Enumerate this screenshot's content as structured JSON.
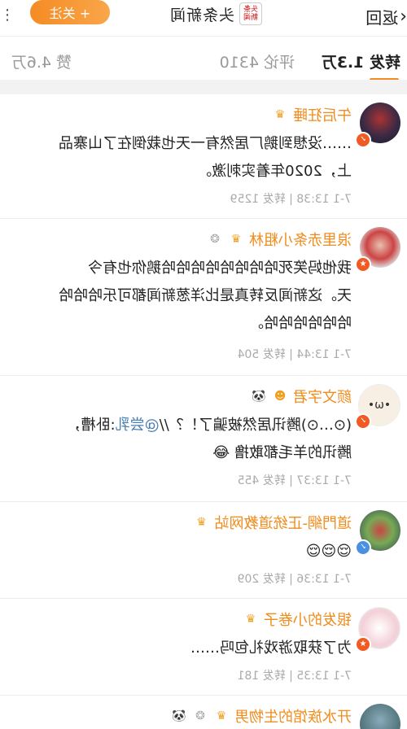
{
  "nav": {
    "back_label": "返回",
    "brand_logo_text": "头条新闻",
    "brand_name": "头条新闻",
    "follow_label": "+ 关注",
    "more_icon": "more-dots-icon"
  },
  "tabs": {
    "repost": "转发 1.3万",
    "comment": "评论 4310",
    "like": "赞 4.6万"
  },
  "posts": [
    {
      "name": "午后狂睡",
      "text1": "……没想到鹅厂居然有一天也栽倒在了山寨品",
      "text2": "上，2020年着实刺激。",
      "meta": "7-1 13:38 | 转发 1259",
      "badge_color": "#f15a22"
    },
    {
      "name": "浪里赤条小粗林",
      "text1": "我他妈笑死哈哈哈哈哈哈哈哈鹅你也有今",
      "text2": "天。这新闻反转真是比洋葱新闻都可乐哈哈哈",
      "text3": "哈哈哈哈哈哈。",
      "meta": "7-1 13:44 | 转发 504",
      "badge_color": "#f15a22"
    },
    {
      "name": "颜文字君",
      "text1_pre": "(⊙…⊙)腾讯居然被骗了！？//",
      "text1_mention": "@尝乳",
      "text1_post": ":卧槽，",
      "text2": "腾讯的羊毛都敢撸 😂",
      "meta": "7-1 13:37 | 转发 455",
      "badge_color": "#f15a22"
    },
    {
      "name": "道門網-正统道教网站",
      "text1": "😌😌😌",
      "meta": "7-1 13:36 | 转发 209",
      "badge_color": "#4a90e2"
    },
    {
      "name": "银发的小卷子",
      "text1": "为了获取游戏礼包吗……",
      "meta": "7-1 13:35 | 转发 181",
      "badge_color": "#f15a22"
    },
    {
      "name": "开水族馆的生物男"
    }
  ]
}
